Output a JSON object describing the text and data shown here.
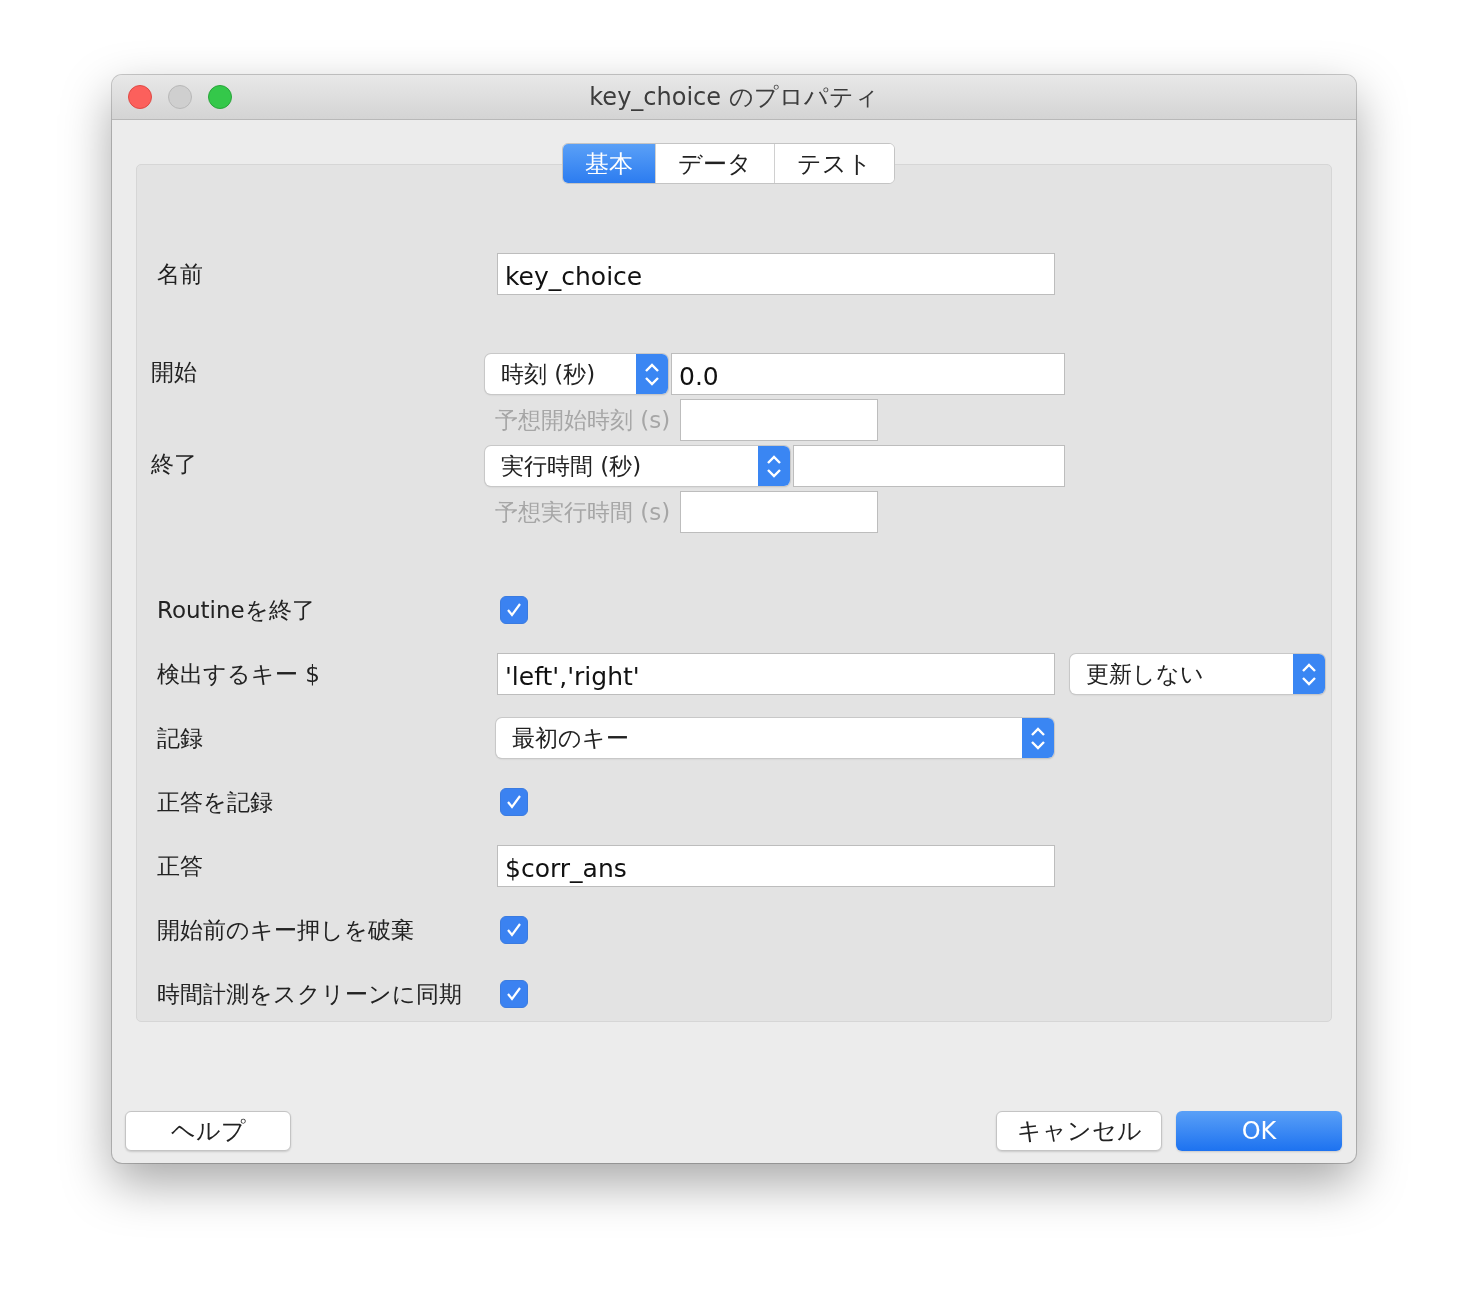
{
  "window": {
    "title": "key_choice のプロパティ",
    "traffic_lights": [
      {
        "kind": "close"
      },
      {
        "kind": "minimize"
      },
      {
        "kind": "zoom"
      }
    ]
  },
  "tabs": [
    {
      "label": "基本",
      "selected": true
    },
    {
      "label": "データ",
      "selected": false
    },
    {
      "label": "テスト",
      "selected": false
    }
  ],
  "rows": [
    {
      "kind": "text",
      "label": "名前",
      "value": "key_choice"
    },
    {
      "kind": "timing",
      "label": "開始",
      "select": "時刻 (秒)",
      "value": "0.0",
      "expected_label": "予想開始時刻 (s)"
    },
    {
      "kind": "timing",
      "label": "終了",
      "select": "実行時間 (秒)",
      "expected_label": "予想実行時間 (s)"
    },
    {
      "kind": "checkbox",
      "label": "Routineを終了",
      "checked": true
    },
    {
      "kind": "text_select",
      "label": "検出するキー $",
      "value": "'left','right'",
      "select": "更新しない"
    },
    {
      "kind": "select",
      "label": "記録",
      "select": "最初のキー"
    },
    {
      "kind": "checkbox",
      "label": "正答を記録",
      "checked": true
    },
    {
      "kind": "text",
      "label": "正答",
      "value": "$corr_ans"
    },
    {
      "kind": "checkbox",
      "label": "開始前のキー押しを破棄",
      "checked": true
    },
    {
      "kind": "checkbox",
      "label": "時間計測をスクリーンに同期",
      "checked": true
    }
  ],
  "buttons": [
    {
      "kind": "help",
      "label": "ヘルプ"
    },
    {
      "kind": "cancel",
      "label": "キャンセル"
    },
    {
      "kind": "ok",
      "label": "OK"
    }
  ]
}
